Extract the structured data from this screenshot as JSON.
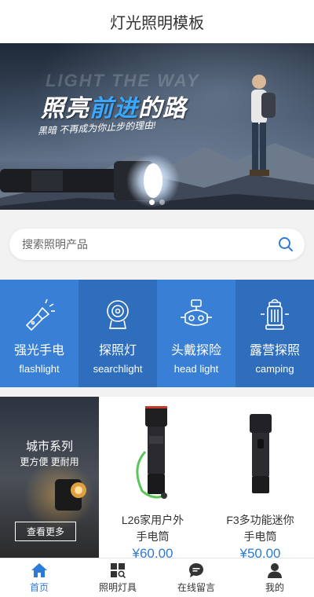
{
  "header": {
    "title": "灯光照明模板"
  },
  "banner": {
    "bg_text": "LIGHT THE WAY",
    "headline_part1": "照亮",
    "headline_highlight": "前进",
    "headline_part2": "的路",
    "subline": "黑暗 不再成为你止步的理由!",
    "slides": 2,
    "active_slide": 1
  },
  "search": {
    "placeholder": "搜索照明产品"
  },
  "categories": [
    {
      "zh": "强光手电",
      "en": "flashlight",
      "icon": "flashlight-icon",
      "color": "#3a7fd6"
    },
    {
      "zh": "探照灯",
      "en": "searchlight",
      "icon": "searchlight-icon",
      "color": "#2f6ebd"
    },
    {
      "zh": "头戴探险",
      "en": "head light",
      "icon": "headlamp-icon",
      "color": "#3a7fd6"
    },
    {
      "zh": "露营探照",
      "en": "camping",
      "icon": "lantern-icon",
      "color": "#2f6ebd"
    }
  ],
  "series": {
    "title": "城市系列",
    "subtitle": "更方便 更耐用",
    "button": "查看更多"
  },
  "products": [
    {
      "name_line1": "L26家用户外",
      "name_line2": "手电筒",
      "price": "¥60.00"
    },
    {
      "name_line1": "F3多功能迷你",
      "name_line2": "手电筒",
      "price": "¥50.00"
    }
  ],
  "tabbar": [
    {
      "label": "首页",
      "icon": "home-icon",
      "active": true
    },
    {
      "label": "照明灯具",
      "icon": "grid-search-icon",
      "active": false
    },
    {
      "label": "在线留言",
      "icon": "chat-icon",
      "active": false
    },
    {
      "label": "我的",
      "icon": "user-icon",
      "active": false
    }
  ],
  "colors": {
    "accent": "#2d7bd6",
    "category_light": "#3a7fd6",
    "category_dark": "#2f6ebd"
  }
}
